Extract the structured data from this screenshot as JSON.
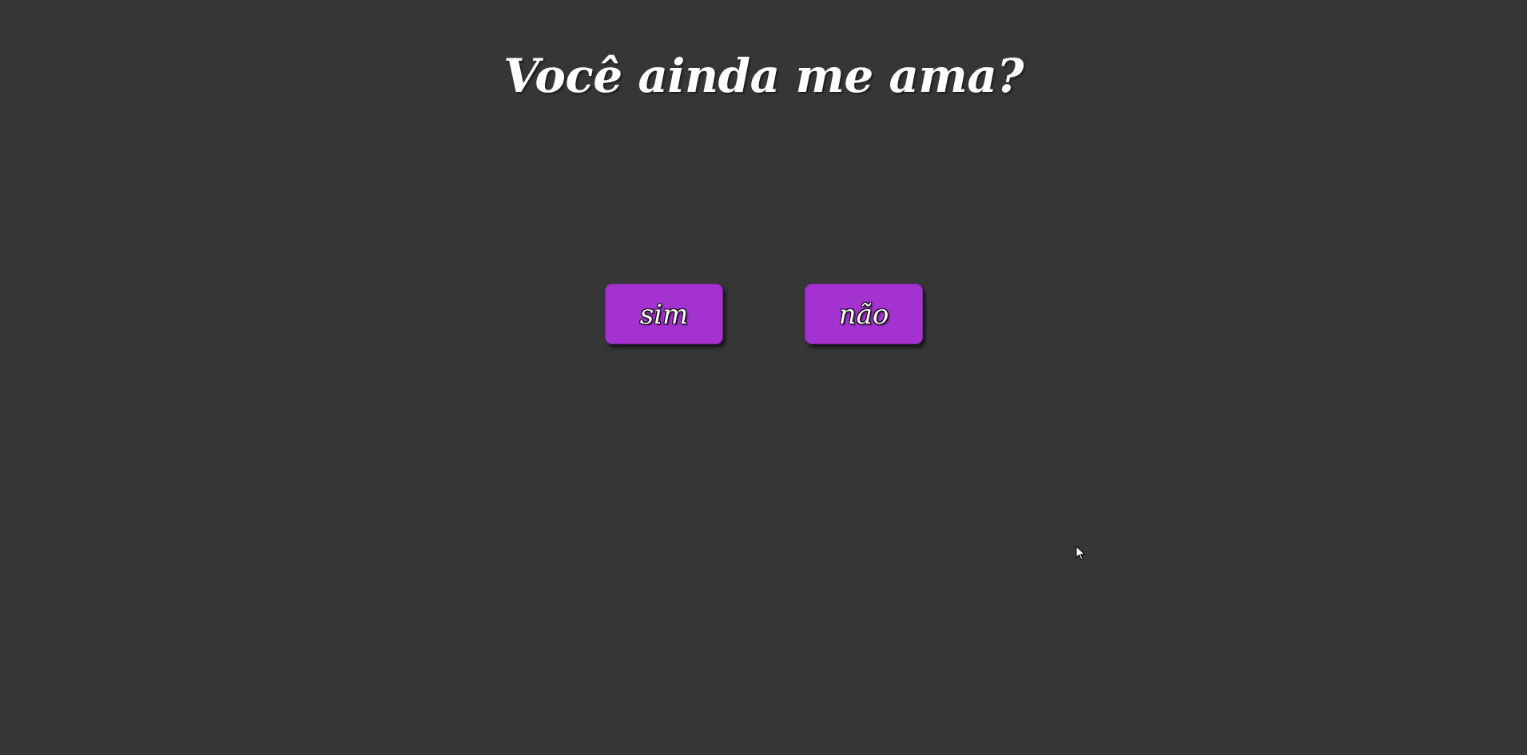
{
  "page": {
    "title": "Você ainda me ama?",
    "background_color": "#363636"
  },
  "buttons": {
    "yes_label": "sim",
    "no_label": "não",
    "color": "#a332d0"
  },
  "cursor": {
    "icon": "mouse-pointer-icon"
  }
}
